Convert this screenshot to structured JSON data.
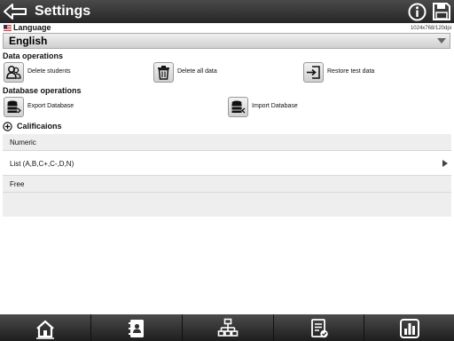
{
  "header": {
    "title": "Settings",
    "back_icon": "back-arrow-icon",
    "info_icon": "info-icon",
    "save_icon": "floppy-disk-icon"
  },
  "language": {
    "label": "Language",
    "resolution": "1024x768/120dpi",
    "selected": "English"
  },
  "data_operations": {
    "title": "Data operations",
    "items": [
      {
        "label": "Delete students",
        "icon": "delete-students-icon"
      },
      {
        "label": "Delete all data",
        "icon": "trash-icon"
      },
      {
        "label": "Restore test data",
        "icon": "restore-icon"
      }
    ]
  },
  "database_operations": {
    "title": "Database operations",
    "items": [
      {
        "label": "Export Database",
        "icon": "export-database-icon"
      },
      {
        "label": "Import Database",
        "icon": "import-database-icon"
      }
    ]
  },
  "califications": {
    "title": "Calificaions",
    "items": [
      {
        "label": "Numeric"
      },
      {
        "label": "List (A,B,C+,C-,D,N)"
      },
      {
        "label": "Free"
      }
    ]
  },
  "bottom_tabs": [
    {
      "icon": "home-icon"
    },
    {
      "icon": "contacts-icon"
    },
    {
      "icon": "hierarchy-icon"
    },
    {
      "icon": "report-icon"
    },
    {
      "icon": "chart-icon"
    }
  ],
  "colors": {
    "bar": "#2e2e2e",
    "list_bg": "#eeeeee",
    "text": "#111111"
  }
}
